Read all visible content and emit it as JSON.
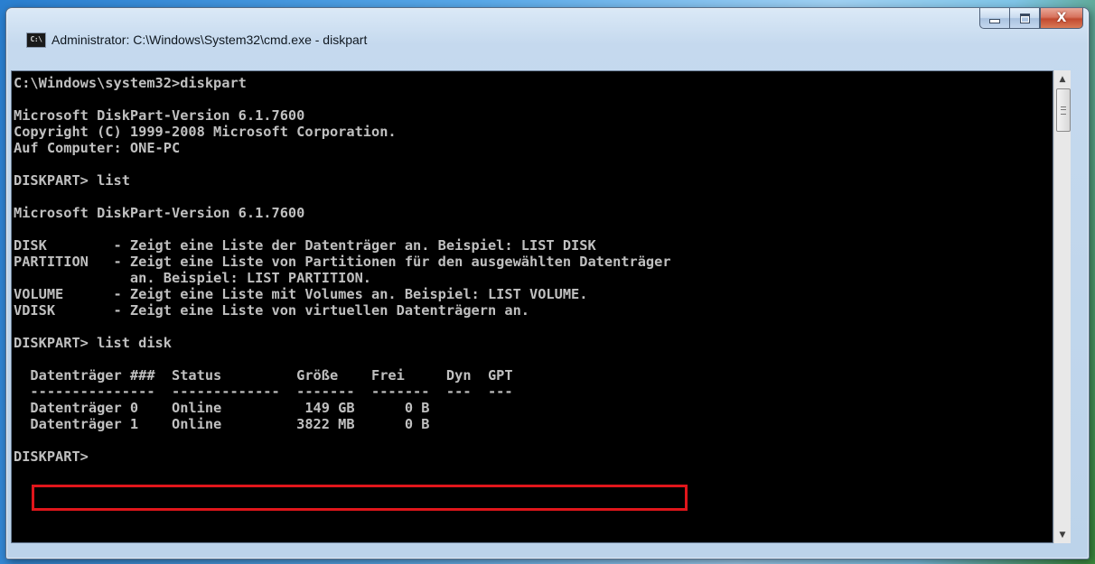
{
  "window": {
    "title": "Administrator: C:\\Windows\\System32\\cmd.exe - diskpart",
    "icon_text": "C:\\",
    "caption_buttons": {
      "minimize_icon": "minimize-icon",
      "maximize_icon": "maximize-icon",
      "close_icon": "close-icon",
      "close_label": "X"
    }
  },
  "console": {
    "lines": [
      "C:\\Windows\\system32>diskpart",
      "",
      "Microsoft DiskPart-Version 6.1.7600",
      "Copyright (C) 1999-2008 Microsoft Corporation.",
      "Auf Computer: ONE-PC",
      "",
      "DISKPART> list",
      "",
      "Microsoft DiskPart-Version 6.1.7600",
      "",
      "DISK        - Zeigt eine Liste der Datenträger an. Beispiel: LIST DISK",
      "PARTITION   - Zeigt eine Liste von Partitionen für den ausgewählten Datenträger",
      "              an. Beispiel: LIST PARTITION.",
      "VOLUME      - Zeigt eine Liste mit Volumes an. Beispiel: LIST VOLUME.",
      "VDISK       - Zeigt eine Liste von virtuellen Datenträgern an.",
      "",
      "DISKPART> list disk",
      "",
      "  Datenträger ###  Status         Größe    Frei     Dyn  GPT",
      "  ---------------  -------------  -------  -------  ---  ---",
      "  Datenträger 0    Online          149 GB      0 B",
      "  Datenträger 1    Online         3822 MB      0 B",
      "",
      "DISKPART>"
    ],
    "highlight_color": "#e0161b"
  },
  "scrollbar": {
    "up_icon": "arrow-up-icon",
    "down_icon": "arrow-down-icon"
  }
}
